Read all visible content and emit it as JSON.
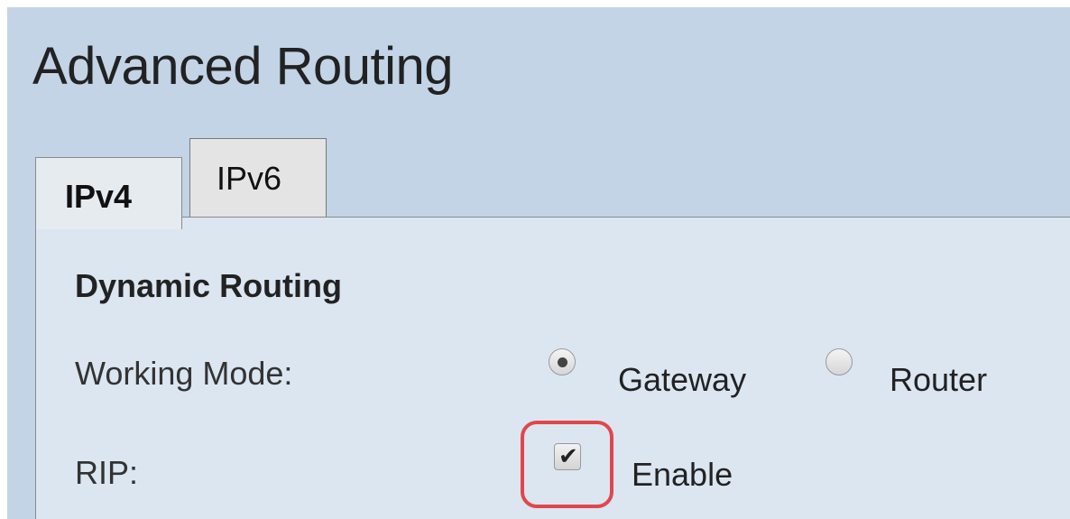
{
  "page": {
    "title": "Advanced Routing"
  },
  "tabs": [
    {
      "label": "IPv4",
      "active": true
    },
    {
      "label": "IPv6",
      "active": false
    }
  ],
  "section": {
    "title": "Dynamic Routing"
  },
  "working_mode": {
    "label": "Working Mode:",
    "options": [
      {
        "label": "Gateway",
        "selected": true
      },
      {
        "label": "Router",
        "selected": false
      }
    ]
  },
  "rip": {
    "label": "RIP:",
    "checkbox_label": "Enable",
    "checked": true,
    "tick_glyph": "✔"
  },
  "colors": {
    "page_background": "#c2d4e6",
    "content_background": "#dbe6f1",
    "highlight_outline": "#e0474c"
  }
}
